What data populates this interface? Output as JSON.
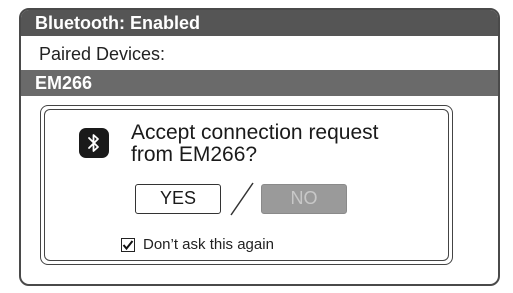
{
  "header": {
    "title": "Bluetooth: Enabled"
  },
  "paired": {
    "label": "Paired Devices:",
    "selected_device": "EM266"
  },
  "dialog": {
    "icon": "bluetooth-icon",
    "message_line1": "Accept connection request",
    "message_line2": "from EM266?",
    "yes_label": "YES",
    "no_label": "NO",
    "dont_ask_label": "Don’t ask this again",
    "dont_ask_checked": true
  }
}
